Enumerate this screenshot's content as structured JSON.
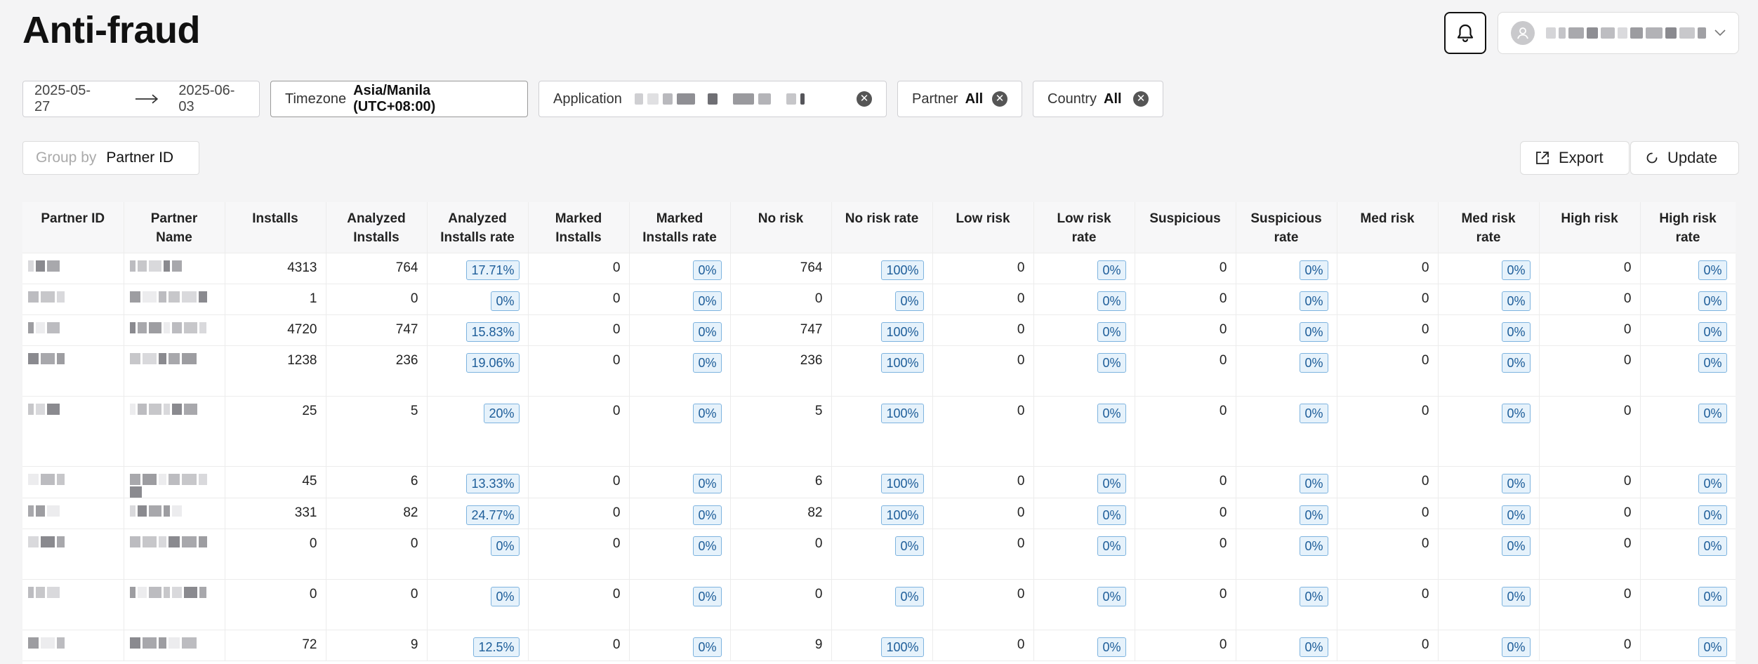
{
  "header": {
    "title": "Anti-fraud",
    "bell_icon": "bell-icon",
    "user_icon": "user-icon"
  },
  "filters": {
    "date_from": "2025-05-27",
    "date_to": "2025-06-03",
    "timezone_label": "Timezone",
    "timezone_value": "Asia/Manila (UTC+08:00)",
    "application_label": "Application",
    "partner_label": "Partner",
    "partner_value": "All",
    "country_label": "Country",
    "country_value": "All",
    "clear_symbol": "✕"
  },
  "toolbar": {
    "group_by_label": "Group by",
    "group_by_value": "Partner ID",
    "export_label": "Export",
    "update_label": "Update"
  },
  "table": {
    "columns": [
      "Partner ID",
      "Partner Name",
      "Installs",
      "Analyzed Installs",
      "Analyzed Installs rate",
      "Marked Installs",
      "Marked Installs rate",
      "No risk",
      "No risk rate",
      "Low risk",
      "Low risk rate",
      "Suspicious",
      "Suspicious rate",
      "Med risk",
      "Med risk rate",
      "High risk",
      "High risk rate"
    ],
    "rows": [
      {
        "installs": "4313",
        "analyzed": "764",
        "analyzed_rate": "17.71%",
        "marked": "0",
        "marked_rate": "0%",
        "no_risk": "764",
        "no_risk_rate": "100%",
        "low": "0",
        "low_rate": "0%",
        "susp": "0",
        "susp_rate": "0%",
        "med": "0",
        "med_rate": "0%",
        "high": "0",
        "high_rate": "0%"
      },
      {
        "installs": "1",
        "analyzed": "0",
        "analyzed_rate": "0%",
        "marked": "0",
        "marked_rate": "0%",
        "no_risk": "0",
        "no_risk_rate": "0%",
        "low": "0",
        "low_rate": "0%",
        "susp": "0",
        "susp_rate": "0%",
        "med": "0",
        "med_rate": "0%",
        "high": "0",
        "high_rate": "0%"
      },
      {
        "installs": "4720",
        "analyzed": "747",
        "analyzed_rate": "15.83%",
        "marked": "0",
        "marked_rate": "0%",
        "no_risk": "747",
        "no_risk_rate": "100%",
        "low": "0",
        "low_rate": "0%",
        "susp": "0",
        "susp_rate": "0%",
        "med": "0",
        "med_rate": "0%",
        "high": "0",
        "high_rate": "0%"
      },
      {
        "installs": "1238",
        "analyzed": "236",
        "analyzed_rate": "19.06%",
        "marked": "0",
        "marked_rate": "0%",
        "no_risk": "236",
        "no_risk_rate": "100%",
        "low": "0",
        "low_rate": "0%",
        "susp": "0",
        "susp_rate": "0%",
        "med": "0",
        "med_rate": "0%",
        "high": "0",
        "high_rate": "0%"
      },
      {
        "installs": "25",
        "analyzed": "5",
        "analyzed_rate": "20%",
        "marked": "0",
        "marked_rate": "0%",
        "no_risk": "5",
        "no_risk_rate": "100%",
        "low": "0",
        "low_rate": "0%",
        "susp": "0",
        "susp_rate": "0%",
        "med": "0",
        "med_rate": "0%",
        "high": "0",
        "high_rate": "0%"
      },
      {
        "installs": "45",
        "analyzed": "6",
        "analyzed_rate": "13.33%",
        "marked": "0",
        "marked_rate": "0%",
        "no_risk": "6",
        "no_risk_rate": "100%",
        "low": "0",
        "low_rate": "0%",
        "susp": "0",
        "susp_rate": "0%",
        "med": "0",
        "med_rate": "0%",
        "high": "0",
        "high_rate": "0%"
      },
      {
        "installs": "331",
        "analyzed": "82",
        "analyzed_rate": "24.77%",
        "marked": "0",
        "marked_rate": "0%",
        "no_risk": "82",
        "no_risk_rate": "100%",
        "low": "0",
        "low_rate": "0%",
        "susp": "0",
        "susp_rate": "0%",
        "med": "0",
        "med_rate": "0%",
        "high": "0",
        "high_rate": "0%"
      },
      {
        "installs": "0",
        "analyzed": "0",
        "analyzed_rate": "0%",
        "marked": "0",
        "marked_rate": "0%",
        "no_risk": "0",
        "no_risk_rate": "0%",
        "low": "0",
        "low_rate": "0%",
        "susp": "0",
        "susp_rate": "0%",
        "med": "0",
        "med_rate": "0%",
        "high": "0",
        "high_rate": "0%"
      },
      {
        "installs": "0",
        "analyzed": "0",
        "analyzed_rate": "0%",
        "marked": "0",
        "marked_rate": "0%",
        "no_risk": "0",
        "no_risk_rate": "0%",
        "low": "0",
        "low_rate": "0%",
        "susp": "0",
        "susp_rate": "0%",
        "med": "0",
        "med_rate": "0%",
        "high": "0",
        "high_rate": "0%"
      },
      {
        "installs": "72",
        "analyzed": "9",
        "analyzed_rate": "12.5%",
        "marked": "0",
        "marked_rate": "0%",
        "no_risk": "9",
        "no_risk_rate": "100%",
        "low": "0",
        "low_rate": "0%",
        "susp": "0",
        "susp_rate": "0%",
        "med": "0",
        "med_rate": "0%",
        "high": "0",
        "high_rate": "0%"
      }
    ]
  },
  "colors": {
    "badge_bg": "#e6f2fb",
    "badge_border": "#7db3df",
    "badge_text": "#1d5d99"
  }
}
